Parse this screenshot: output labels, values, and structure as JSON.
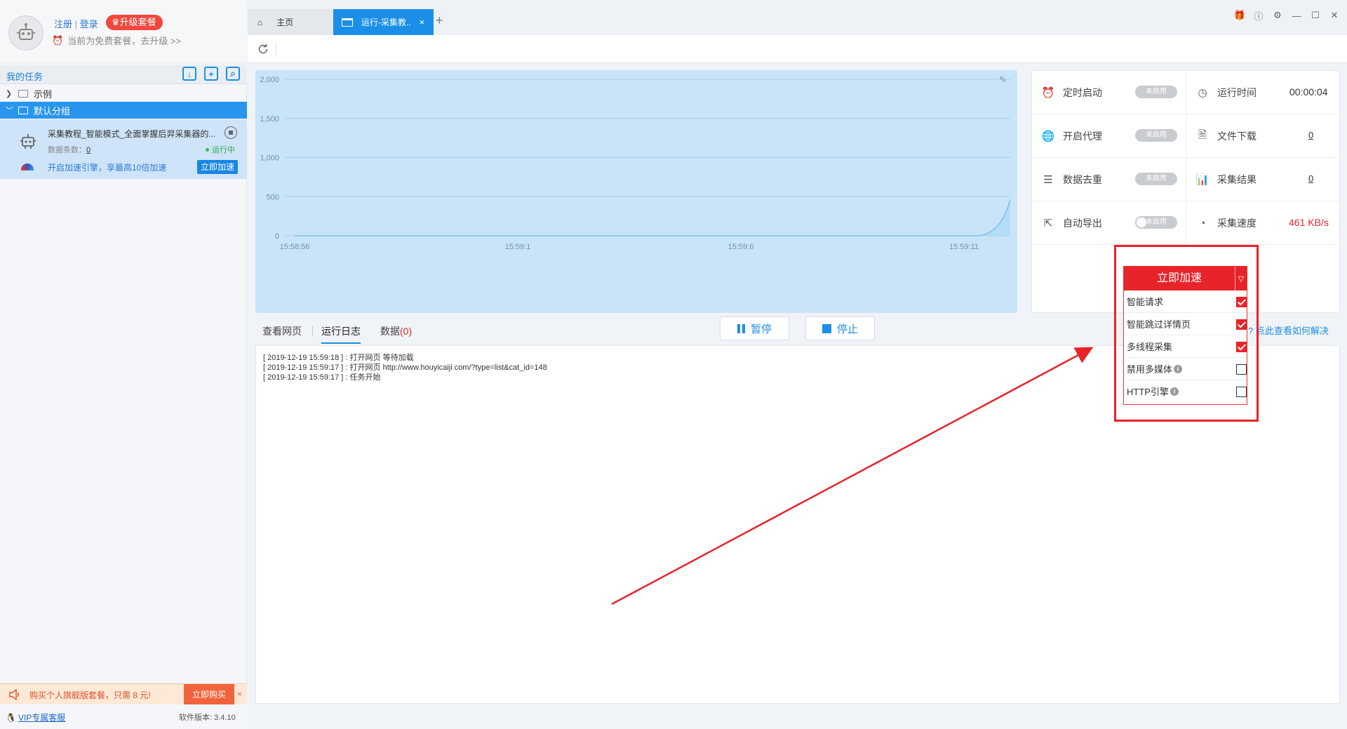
{
  "profile": {
    "register": "注册",
    "login": "登录",
    "auth_separator": "|",
    "upgrade_badge": "升级套餐",
    "free_notice": "当前为免费套餐，去升级 >>"
  },
  "sidebar": {
    "title": "我的任务",
    "groups": [
      {
        "label": "示例"
      },
      {
        "label": "默认分组"
      }
    ],
    "task": {
      "name": "采集教程_智能模式_全面掌握后羿采集器的...",
      "data_count_label": "数据条数：",
      "data_count_value": "0",
      "status": "运行中",
      "accel_promo": "开启加速引擎，享最高10倍加速",
      "accel_button": "立即加速"
    }
  },
  "promo": {
    "text": "购买个人旗舰版套餐，只需 8 元!",
    "buy_button": "立即购买",
    "close": "×"
  },
  "footer": {
    "vip_support": "VIP专属客服",
    "version": "软件版本: 3.4.10"
  },
  "tabs": {
    "home": "主页",
    "active": "运行-采集教..",
    "close": "×",
    "add": "+"
  },
  "chart_data": {
    "type": "area",
    "x_tick_labels": [
      "15:58:56",
      "15:59:1",
      "15:59:6",
      "15:59:11"
    ],
    "y_tick_labels": [
      "2,000",
      "1,500",
      "1,000",
      "500",
      "0"
    ],
    "ylim": [
      0,
      2000
    ],
    "grid": true,
    "series": [
      {
        "values": [
          0,
          0,
          0,
          0,
          0,
          0,
          0,
          0,
          0,
          0,
          0,
          0,
          0,
          0,
          0,
          0,
          0,
          0,
          0,
          0,
          0,
          461
        ]
      }
    ],
    "colors": {
      "fill": "#b3dcf7",
      "line": "#7ac0ef",
      "background": "#c9e4f8",
      "grid": "#a8cce6"
    }
  },
  "options": {
    "schedule": {
      "label": "定时启动",
      "state": "未启用"
    },
    "run_time": {
      "label": "运行时间",
      "value": "00:00:04"
    },
    "proxy": {
      "label": "开启代理",
      "state": "未启用"
    },
    "file_download": {
      "label": "文件下载",
      "value": "0"
    },
    "dedupe": {
      "label": "数据去重",
      "state": "未启用"
    },
    "results": {
      "label": "采集结果",
      "value": "0"
    },
    "auto_export": {
      "label": "自动导出",
      "state": "未启用"
    },
    "speed": {
      "label": "采集速度",
      "value": "461 KB/s"
    }
  },
  "view_tabs": {
    "webpage": "查看网页",
    "log": "运行日志",
    "data": "数据",
    "data_count": "(0)"
  },
  "actions": {
    "pause": "暂停",
    "stop": "停止"
  },
  "help_link": "点此查看如何解决",
  "help_prefix": "?",
  "log_lines": [
    "[ 2019-12-19 15:59:18 ] : 打开网页 等待加载",
    "[ 2019-12-19 15:59:17 ] : 打开网页 http://www.houyicaiji.com/?type=list&cat_id=148",
    "[ 2019-12-19 15:59:17 ] : 任务开始"
  ],
  "accel_menu": {
    "title": "立即加速",
    "items": [
      {
        "label": "智能请求",
        "checked": true
      },
      {
        "label": "智能跳过详情页",
        "checked": true
      },
      {
        "label": "多线程采集",
        "checked": true
      },
      {
        "label": "禁用多媒体",
        "checked": false
      },
      {
        "label": "HTTP引擎",
        "checked": false
      }
    ]
  },
  "colors": {
    "accent": "#1b8fe8",
    "annotation_red": "#e8232a",
    "running_green": "#2aa84a"
  }
}
